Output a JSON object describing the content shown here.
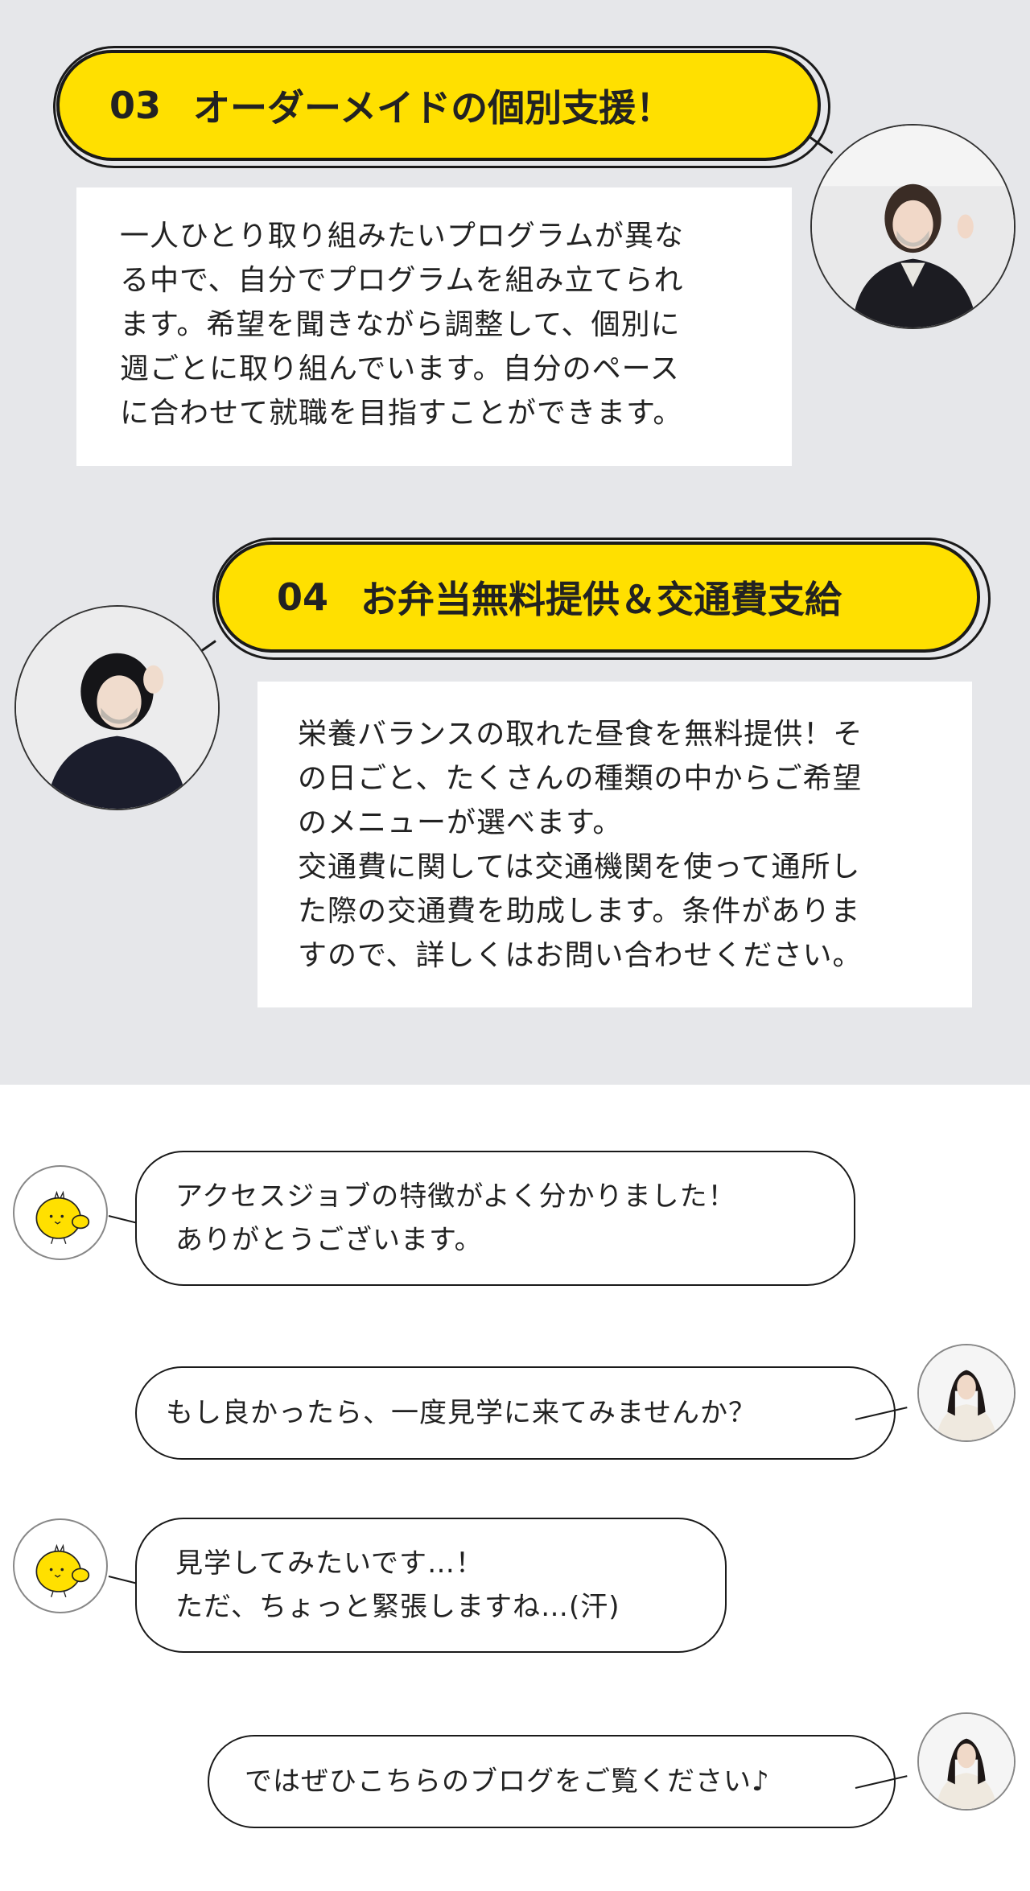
{
  "section3": {
    "number": "03",
    "title": "オーダーメイドの個別支援！",
    "lines": [
      "一人ひとり取り組みたいプログラムが異な",
      "る中で、自分でプログラムを組み立てられ",
      "ます。希望を聞きながら調整して、個別に",
      "週ごとに取り組んでいます。自分のペース",
      "に合わせて就職を目指すことができます。"
    ]
  },
  "section4": {
    "number": "04",
    "title": "お弁当無料提供＆交通費支給",
    "lines": [
      "栄養バランスの取れた昼食を無料提供！そ",
      "の日ごと、たくさんの種類の中からご希望",
      "のメニューが選べます。",
      "交通費に関しては交通機関を使って通所し",
      "た際の交通費を助成します。条件がありま",
      "すので、詳しくはお問い合わせください。"
    ]
  },
  "chat": [
    {
      "speaker": "chick",
      "lines": [
        "アクセスジョブの特徴がよく分かりました！",
        "ありがとうございます。"
      ]
    },
    {
      "speaker": "staff",
      "lines": [
        "もし良かったら、一度見学に来てみませんか？"
      ]
    },
    {
      "speaker": "chick",
      "lines": [
        "見学してみたいです…！",
        "ただ、ちょっと緊張しますね…(汗)"
      ]
    },
    {
      "speaker": "staff",
      "lines": [
        "ではぜひこちらのブログをご覧ください♪"
      ]
    }
  ],
  "colors": {
    "accent": "#ffe000",
    "background_grey": "#e6e7ea"
  }
}
